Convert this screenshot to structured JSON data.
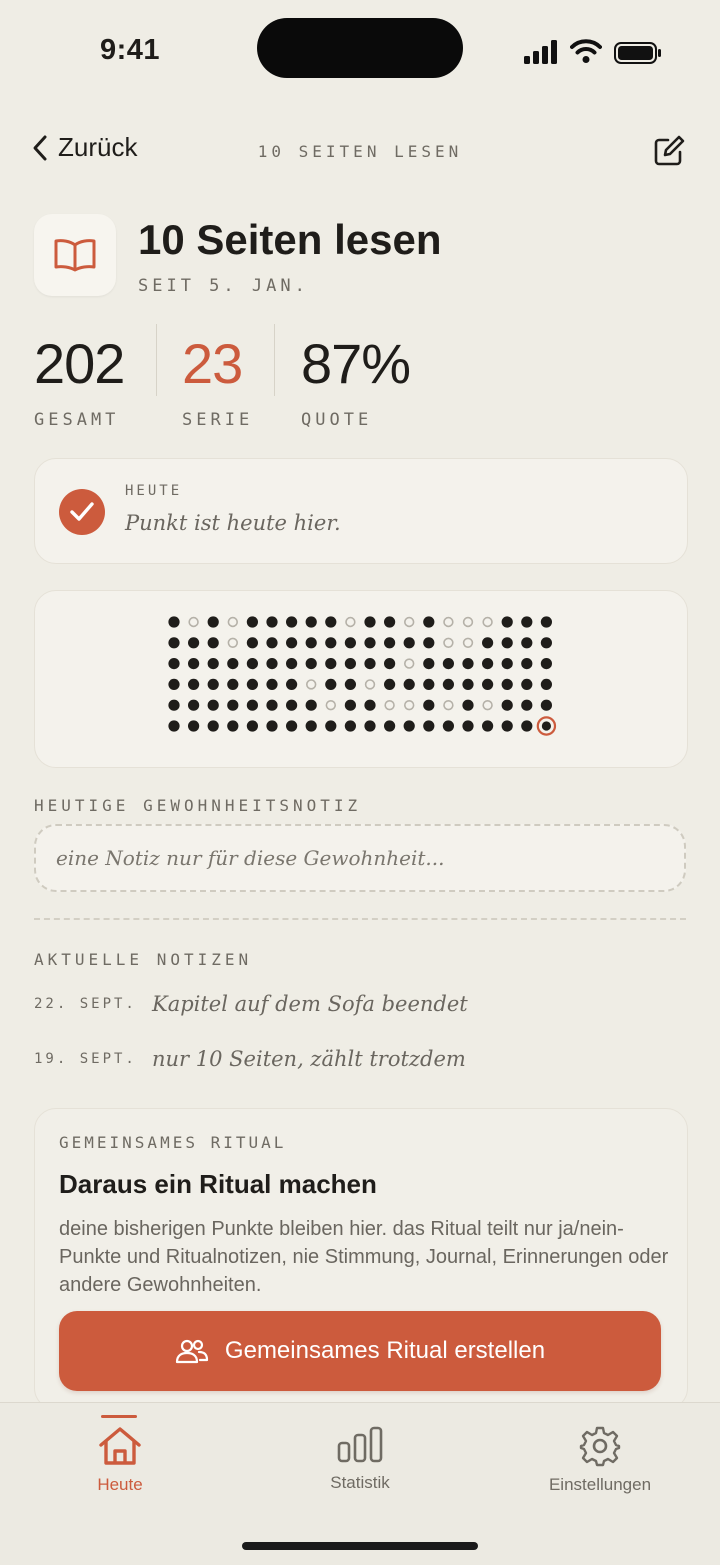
{
  "status_bar": {
    "time": "9:41"
  },
  "nav": {
    "back_label": "Zurück",
    "title": "10 SEITEN LESEN"
  },
  "habit": {
    "title": "10 Seiten lesen",
    "since": "SEIT 5. JAN.",
    "icon": "book-icon"
  },
  "stats": [
    {
      "value": "202",
      "label": "GESAMT",
      "color": "#1f1d1a"
    },
    {
      "value": "23",
      "label": "SERIE",
      "color": "#cc5b3d"
    },
    {
      "value": "87%",
      "label": "QUOTE",
      "color": "#1f1d1a"
    }
  ],
  "today": {
    "label": "HEUTE",
    "text": "Punkt ist heute hier."
  },
  "dot_grid": {
    "rows": [
      "xoxoxxxxxoxxoxoooxxx",
      "xxxoxxxxxxxxxxooxxxx",
      "xxxxxxxxxxxxoxxxxxxx",
      "xxxxxxxoxxoxxxxxxxxx",
      "xxxxxxxxoxxooxoxoxxx",
      "xxxxxxxxxxxxxxxxxxxT"
    ],
    "legend": {
      "x": "done",
      "o": "missed",
      "T": "today"
    },
    "filled_color": "#1f1d1a",
    "empty_color": "#b5b1a8",
    "today_color": "#cc5b3d"
  },
  "note_section": {
    "label": "HEUTIGE GEWOHNHEITSNOTIZ",
    "placeholder": "eine Notiz nur für diese Gewohnheit..."
  },
  "recent_notes": {
    "label": "AKTUELLE NOTIZEN",
    "items": [
      {
        "date": "22. SEPT.",
        "text": "Kapitel auf dem Sofa beendet"
      },
      {
        "date": "19. SEPT.",
        "text": "nur 10 Seiten, zählt trotzdem"
      }
    ]
  },
  "ritual": {
    "label": "GEMEINSAMES RITUAL",
    "title": "Daraus ein Ritual machen",
    "description": "deine bisherigen Punkte bleiben hier. das Ritual teilt nur ja/nein-Punkte und Ritualnotizen, nie Stimmung, Journal, Erinnerungen oder andere Gewohnheiten.",
    "button_label": "Gemeinsames Ritual erstellen"
  },
  "tabs": [
    {
      "label": "Heute",
      "icon": "home-icon",
      "active": true
    },
    {
      "label": "Statistik",
      "icon": "bar-chart-icon",
      "active": false
    },
    {
      "label": "Einstellungen",
      "icon": "gear-icon",
      "active": false
    }
  ],
  "colors": {
    "accent": "#cc5b3d",
    "background": "#efede5",
    "card": "#f4f2ec"
  }
}
